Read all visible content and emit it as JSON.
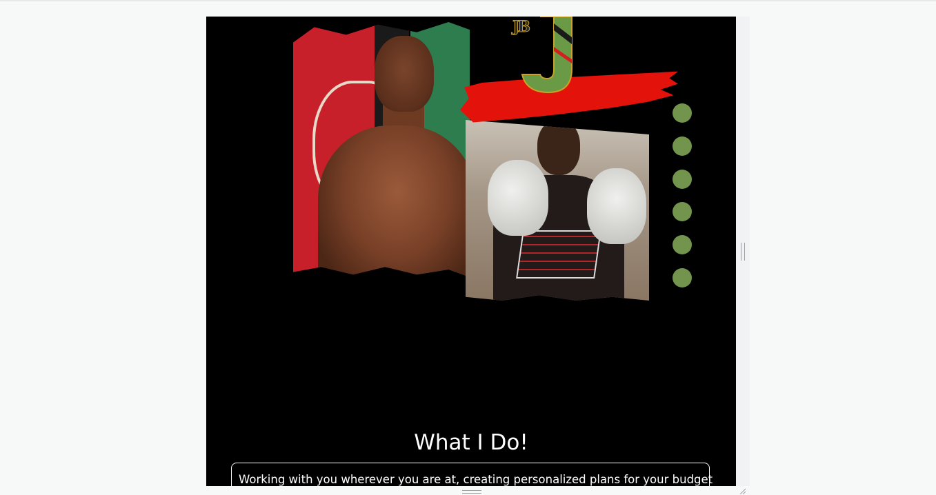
{
  "page": {
    "background": "#f7f8f8"
  },
  "hero": {
    "logo_mark": "JB",
    "dots_color": "#73944d",
    "dot_count": 6,
    "accent_red": "#e3120b"
  },
  "section": {
    "title": "What I Do!",
    "body": "Working with you wherever you are at, creating personalized plans for your budget"
  }
}
